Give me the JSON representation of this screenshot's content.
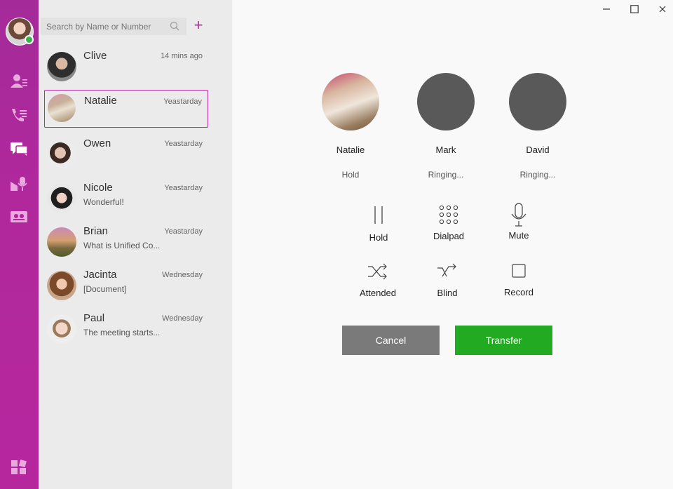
{
  "window": {
    "minimize_icon": "minimize-icon",
    "maximize_icon": "maximize-icon",
    "close_icon": "close-icon"
  },
  "rail": {
    "user_status": "online",
    "items": [
      {
        "icon": "contacts-icon"
      },
      {
        "icon": "call-log-icon"
      },
      {
        "icon": "chat-icon"
      },
      {
        "icon": "voicemail-icon"
      },
      {
        "icon": "meeting-icon"
      },
      {
        "icon": "apps-grid-icon"
      }
    ],
    "accent_color": "#b12ca0"
  },
  "search": {
    "placeholder": "Search by Name or Number",
    "add_label": "+"
  },
  "conversations": [
    {
      "name": "Clive",
      "time": "14 mins ago",
      "message": ""
    },
    {
      "name": "Natalie",
      "time": "Yeastarday",
      "message": "",
      "selected": true
    },
    {
      "name": "Owen",
      "time": "Yeastarday",
      "message": ""
    },
    {
      "name": "Nicole",
      "time": "Yeastarday",
      "message": "Wonderful!"
    },
    {
      "name": "Brian",
      "time": "Yeastarday",
      "message": "What is Unified Co..."
    },
    {
      "name": "Jacinta",
      "time": "Wednesday",
      "message": "[Document]"
    },
    {
      "name": "Paul",
      "time": "Wednesday",
      "message": "The meeting starts..."
    }
  ],
  "parties": [
    {
      "name": "Natalie",
      "status": "Hold"
    },
    {
      "name": "Mark",
      "status": "Ringing..."
    },
    {
      "name": "David",
      "status": "Ringing..."
    }
  ],
  "controls": {
    "hold": "Hold",
    "dialpad": "Dialpad",
    "mute": "Mute",
    "attended": "Attended",
    "blind": "Blind",
    "record": "Record"
  },
  "actions": {
    "cancel": "Cancel",
    "transfer": "Transfer",
    "cancel_color": "#7a7a7a",
    "transfer_color": "#22aa22"
  }
}
